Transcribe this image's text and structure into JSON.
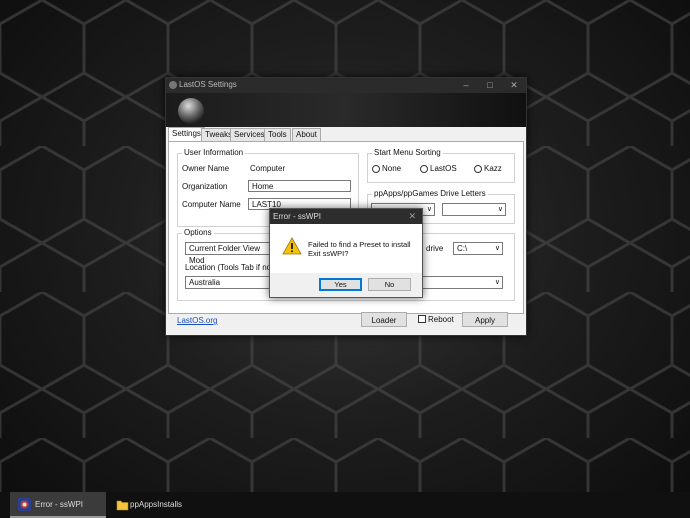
{
  "main_window": {
    "title": "LastOS Settings",
    "tabs": [
      "Settings",
      "Tweaks",
      "Services",
      "Tools",
      "About"
    ],
    "user_info": {
      "group_label": "User Information",
      "owner_label": "Owner Name",
      "owner_value": "Computer",
      "org_label": "Organization",
      "org_value": "Home",
      "computer_label": "Computer Name",
      "computer_value": "LAST10"
    },
    "start_menu": {
      "group_label": "Start Menu Sorting",
      "options": [
        "None",
        "LastOS",
        "Kazz"
      ]
    },
    "drive_letters": {
      "group_label": "ppApps/ppGames Drive Letters",
      "left_value": "",
      "right_value": ""
    },
    "options": {
      "group_label": "Options",
      "folder_view_value": "Current Folder View Mod",
      "drive_label": "drive",
      "drive_value": "C:\\",
      "location_label": "Location (Tools Tab if not a",
      "location_value": "Australia"
    },
    "footer": {
      "link": "LastOS.org",
      "loader_button": "Loader",
      "reboot_label": "Reboot",
      "apply_button": "Apply"
    }
  },
  "error_dialog": {
    "title": "Error - ssWPI",
    "message_line1": "Failed to find a Preset to install",
    "message_line2": "Exit ssWPI?",
    "yes_button": "Yes",
    "no_button": "No",
    "icon": "warning-icon"
  },
  "taskbar": {
    "items": [
      {
        "label": "Error - ssWPI",
        "icon": "sswpi-icon",
        "active": true
      },
      {
        "label": "ppAppsInstalls",
        "icon": "folder-icon",
        "active": false
      }
    ]
  },
  "colors": {
    "warning_yellow": "#f4c20d",
    "link_blue": "#1a4fbf",
    "default_button_border": "#0078d7"
  }
}
